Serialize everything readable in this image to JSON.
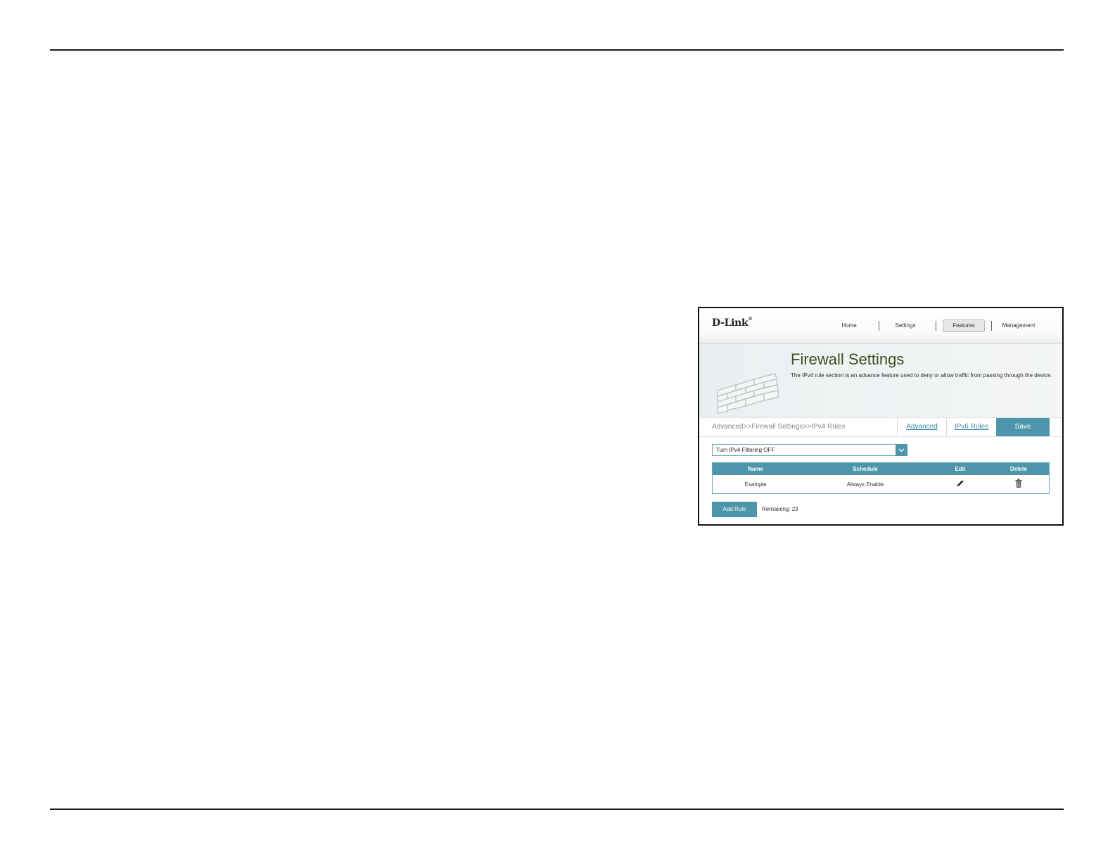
{
  "header": {
    "logo": "D-Link",
    "logo_mark": "®",
    "nav": [
      {
        "label": "Home"
      },
      {
        "label": "Settings"
      },
      {
        "label": "Features"
      },
      {
        "label": "Management"
      }
    ],
    "active_nav": "Features"
  },
  "banner": {
    "title": "Firewall Settings",
    "description": "The IPv4 rule section is an advance feature used to deny or allow traffic from passing through the device.",
    "icon": "brick-wall-icon"
  },
  "breadcrumb": {
    "path": "Advanced>>Firewall Settings>>IPv4 Rules",
    "links": [
      {
        "label": "Advanced"
      },
      {
        "label": "IPv6 Rules"
      }
    ],
    "save_label": "Save"
  },
  "filter": {
    "selected": "Turn IPv4 Filtering OFF",
    "icon": "chevron-down-icon"
  },
  "rules_table": {
    "columns": [
      "Name",
      "Schedule",
      "Edit",
      "Delete"
    ],
    "rows": [
      {
        "name": "Example",
        "schedule": "Always Enable",
        "edit_icon": "pencil-icon",
        "delete_icon": "trash-icon"
      }
    ]
  },
  "footer_actions": {
    "add_label": "Add Rule",
    "remaining": "Remaining: 23"
  },
  "colors": {
    "accent": "#4c95ab",
    "title_green": "#3e4f1e",
    "link": "#3a8aa6"
  }
}
